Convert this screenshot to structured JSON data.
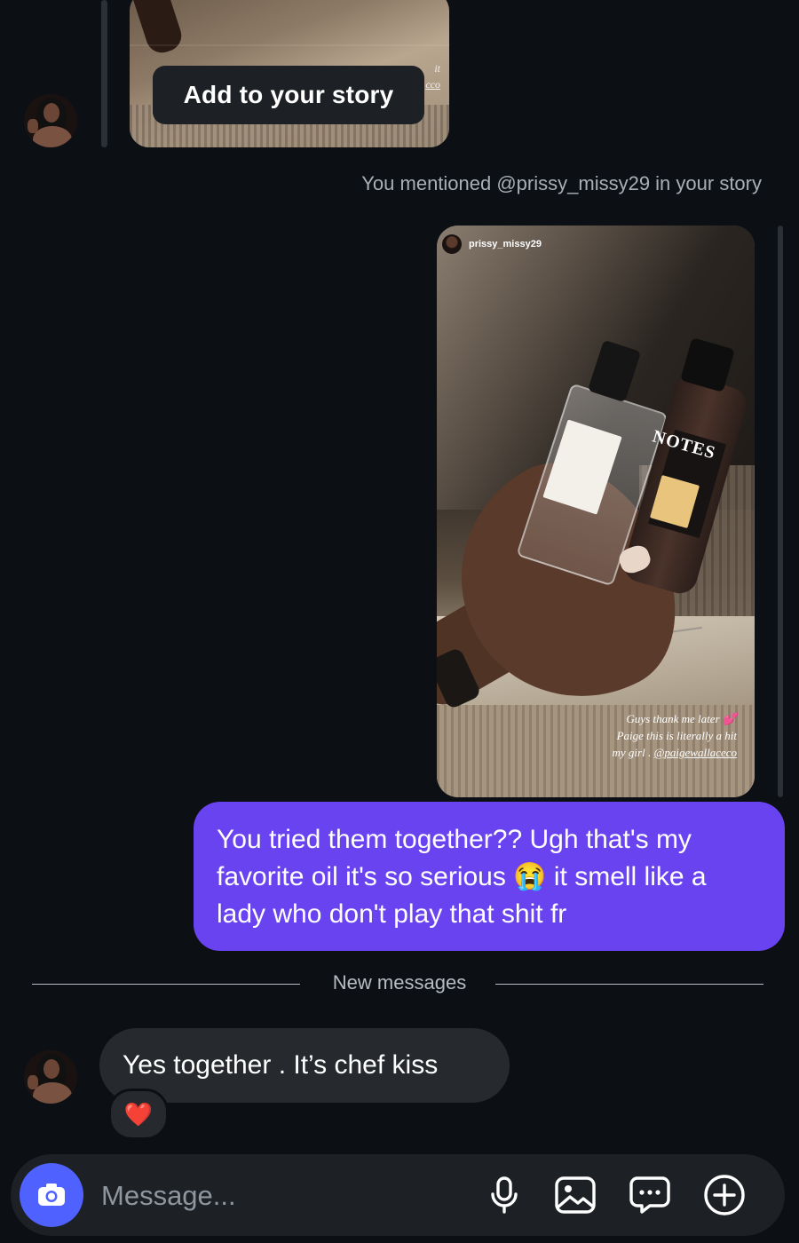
{
  "top_story": {
    "tooltip_label": "Add to your story",
    "caption_fragment_1": "it",
    "caption_fragment_2": "cco"
  },
  "mention_note": "You mentioned @prissy_missy29 in your story",
  "story_card": {
    "username": "prissy_missy29",
    "caption_line_1": "Guys thank me later 💕",
    "caption_line_2": "Paige this is literally a hit",
    "caption_line_3_prefix": "my girl . ",
    "caption_link": "@paigewallaceco",
    "product_text": "NOTES"
  },
  "my_message": "You tried them together?? Ugh that's my favorite oil it's so serious 😭 it smell like a lady who don't play that shit fr",
  "divider_label": "New messages",
  "their_message": "Yes together . It’s chef kiss",
  "reaction_emoji": "❤️",
  "composer": {
    "placeholder": "Message..."
  },
  "icons": {
    "camera": "camera-icon",
    "mic": "microphone-icon",
    "gallery": "gallery-icon",
    "chat": "chat-bubble-icon",
    "add": "plus-circle-icon"
  },
  "colors": {
    "background": "#0c1014",
    "my_bubble": "#6a43f0",
    "their_bubble": "#262a2f",
    "camera_button": "#4f62ff",
    "reaction": "#ff2d4f"
  }
}
